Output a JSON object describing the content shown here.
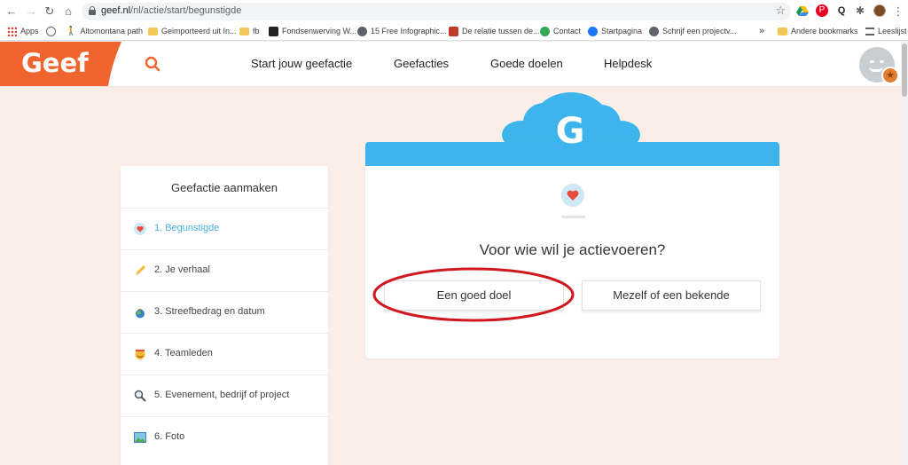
{
  "browser": {
    "url_host": "geef.nl",
    "url_path": "/nl/actie/start/begunstigde",
    "bookmarks": [
      {
        "label": "Apps"
      },
      {
        "label": ""
      },
      {
        "label": "Altomontana path"
      },
      {
        "label": "Geimporteerd uit In..."
      },
      {
        "label": "fb"
      },
      {
        "label": "Fondsenwerving W..."
      },
      {
        "label": "15 Free Infographic..."
      },
      {
        "label": "De relatie tussen de..."
      },
      {
        "label": "Contact"
      },
      {
        "label": "Startpagina"
      },
      {
        "label": "Schrijf een projectv..."
      }
    ],
    "bookmarks_more": "»",
    "other_bookmarks": "Andere bookmarks",
    "reading_list": "Leeslijst"
  },
  "site": {
    "logo": "Geef",
    "nav": [
      "Start jouw geefactie",
      "Geefacties",
      "Goede doelen",
      "Helpdesk"
    ],
    "brand_color": "#f0642d",
    "accent_color": "#3db5ec"
  },
  "steps": {
    "title": "Geefactie aanmaken",
    "items": [
      {
        "label": "1. Begunstigde",
        "icon": "heart-icon",
        "active": true
      },
      {
        "label": "2. Je verhaal",
        "icon": "pencil-icon",
        "active": false
      },
      {
        "label": "3. Streefbedrag en datum",
        "icon": "money-bag-icon",
        "active": false
      },
      {
        "label": "4. Teamleden",
        "icon": "team-icon",
        "active": false
      },
      {
        "label": "5. Evenement, bedrijf of project",
        "icon": "magnifier-icon",
        "active": false
      },
      {
        "label": "6. Foto",
        "icon": "photo-icon",
        "active": false
      }
    ]
  },
  "card": {
    "badge_letter": "G",
    "question": "Voor wie wil je actievoeren?",
    "options": [
      "Een goed doel",
      "Mezelf of een bekende"
    ]
  }
}
